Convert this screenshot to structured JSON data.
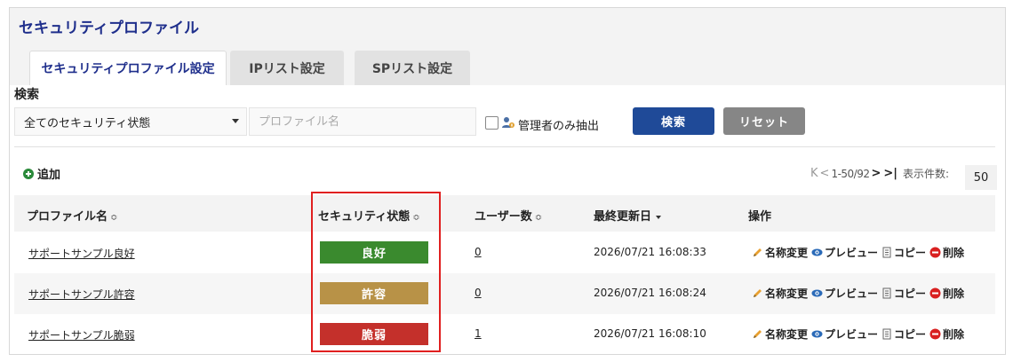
{
  "page": {
    "title": "セキュリティプロファイル"
  },
  "tabs": [
    {
      "label": "セキュリティプロファイル設定",
      "active": true
    },
    {
      "label": "IPリスト設定",
      "active": false
    },
    {
      "label": "SPリスト設定",
      "active": false
    }
  ],
  "search": {
    "label": "検索",
    "status_select": "全てのセキュリティ状態",
    "profile_placeholder": "プロファイル名",
    "admin_only_label": "管理者のみ抽出",
    "admin_only_checked": false,
    "search_button": "検索",
    "reset_button": "リセット"
  },
  "toolbar": {
    "add_label": "追加",
    "pager": {
      "first": "K",
      "prev": "<",
      "range": "1-50/92",
      "next": ">",
      "last": ">|",
      "per_page_label": "表示件数:",
      "per_page": "50"
    }
  },
  "table": {
    "columns": [
      {
        "label": "プロファイル名",
        "sort": "both"
      },
      {
        "label": "セキュリティ状態",
        "sort": "both"
      },
      {
        "label": "ユーザー数",
        "sort": "both"
      },
      {
        "label": "最終更新日",
        "sort": "desc"
      },
      {
        "label": "操作",
        "sort": "none"
      }
    ],
    "rows": [
      {
        "name": "サポートサンプル良好",
        "status": "良好",
        "status_color": "#3a8a2e",
        "users": "0",
        "updated": "2026/07/21 16:08:33"
      },
      {
        "name": "サポートサンプル許容",
        "status": "許容",
        "status_color": "#b89247",
        "users": "0",
        "updated": "2026/07/21 16:08:24"
      },
      {
        "name": "サポートサンプル脆弱",
        "status": "脆弱",
        "status_color": "#c4302b",
        "users": "1",
        "updated": "2026/07/21 16:08:10"
      }
    ],
    "actions": {
      "rename": "名称変更",
      "preview": "プレビュー",
      "copy": "コピー",
      "delete": "削除"
    }
  },
  "colors": {
    "primary": "#1f4a98",
    "title": "#1f2f8c",
    "highlight": "#e02020"
  }
}
